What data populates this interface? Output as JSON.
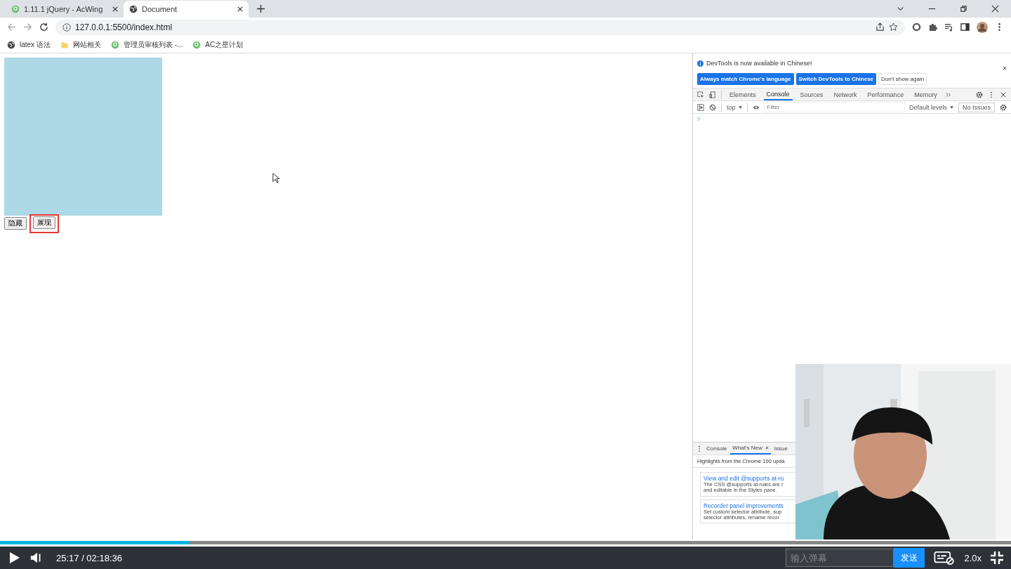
{
  "browser_tabs": [
    {
      "title": "1.11.1 jQuery - AcWing",
      "selected": false,
      "kind": "site"
    },
    {
      "title": "Document",
      "selected": true,
      "kind": "globe"
    }
  ],
  "address": "127.0.0.1:5500/index.html",
  "bookmarks": [
    {
      "label": "latex 语法",
      "kind": "globe"
    },
    {
      "label": "网站相关",
      "kind": "folder"
    },
    {
      "label": "管理员审核列表 -...",
      "kind": "site"
    },
    {
      "label": "AC之星计划",
      "kind": "site"
    }
  ],
  "page": {
    "buttons": [
      {
        "label": "隐藏",
        "highlighted": false
      },
      {
        "label": "展现",
        "highlighted": true
      }
    ]
  },
  "devtools": {
    "notice": "DevTools is now available in Chinese!",
    "notice_buttons": [
      {
        "label": "Always match Chrome's language",
        "kind": "primary"
      },
      {
        "label": "Switch DevTools to Chinese",
        "kind": "primary"
      },
      {
        "label": "Don't show again",
        "kind": "plain"
      }
    ],
    "tabs": [
      {
        "label": "Elements",
        "selected": false
      },
      {
        "label": "Console",
        "selected": true
      },
      {
        "label": "Sources",
        "selected": false
      },
      {
        "label": "Network",
        "selected": false
      },
      {
        "label": "Performance",
        "selected": false
      },
      {
        "label": "Memory",
        "selected": false
      }
    ],
    "context": "top",
    "filter_placeholder": "Filter",
    "levels": "Default levels",
    "issues": "No Issues",
    "drawer_tabs": [
      {
        "label": "Console",
        "selected": false
      },
      {
        "label": "What's New",
        "selected": true
      },
      {
        "label": "Issue",
        "selected": false
      }
    ],
    "drawer_heading": "Highlights from the Chrome 100 upda",
    "drawer_cards": [
      {
        "title": "View and edit @supports at-ru",
        "lines": [
          "The CSS @supports at-rules are r",
          "and editable in the Styles pane."
        ]
      },
      {
        "title": "Recorder panel improvements",
        "lines": [
          "Set custom selector attribute, sup",
          "selector attributes, rename recor"
        ]
      }
    ]
  },
  "player": {
    "level": 0.187,
    "time": "25:17 / 02:18:36",
    "danmaku_placeholder": "输入弹幕",
    "send": "发送",
    "speed": "2.0x"
  }
}
